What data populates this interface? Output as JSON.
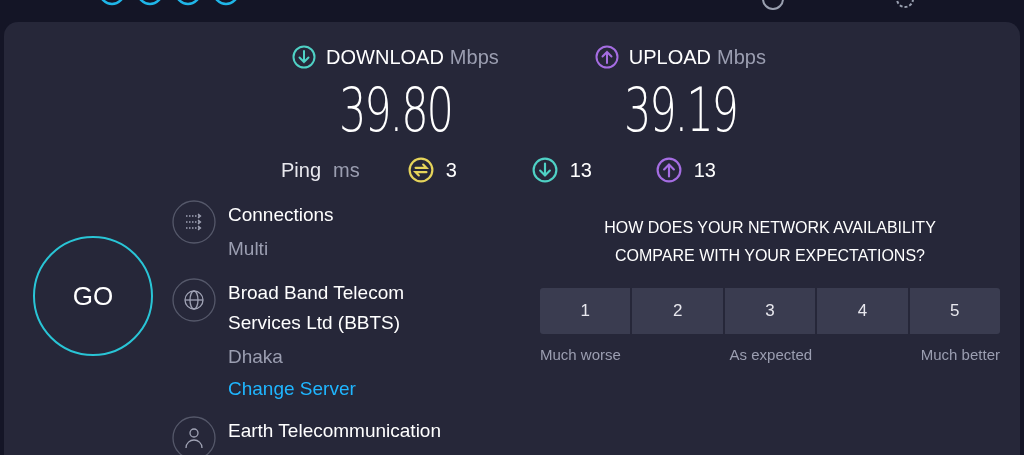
{
  "speeds": [
    {
      "kind": "download",
      "label": "DOWNLOAD",
      "unit": "Mbps",
      "value": "39.80"
    },
    {
      "kind": "upload",
      "label": "UPLOAD",
      "unit": "Mbps",
      "value": "39.19"
    }
  ],
  "ping": {
    "label": "Ping",
    "unit": "ms",
    "readings": [
      {
        "kind": "idle",
        "value": "3"
      },
      {
        "kind": "download",
        "value": "13"
      },
      {
        "kind": "upload",
        "value": "13"
      }
    ]
  },
  "go_button": "GO",
  "info": [
    {
      "kind": "connections",
      "title": "Connections",
      "detail": "Multi"
    },
    {
      "kind": "server",
      "title": "Broad Band Telecom Services Ltd (BBTS)",
      "detail": "Dhaka",
      "link": "Change Server"
    },
    {
      "kind": "provider",
      "title": "Earth Telecommunication"
    }
  ],
  "survey": {
    "question": "HOW DOES YOUR NETWORK AVAILABILITY COMPARE WITH YOUR EXPECTATIONS?",
    "options": [
      {
        "label": "1",
        "selected": false
      },
      {
        "label": "2",
        "selected": false
      },
      {
        "label": "3",
        "selected": false
      },
      {
        "label": "4",
        "selected": false
      },
      {
        "label": "5",
        "selected": false
      }
    ],
    "scale_labels": [
      "Much worse",
      "As expected",
      "Much better"
    ]
  }
}
